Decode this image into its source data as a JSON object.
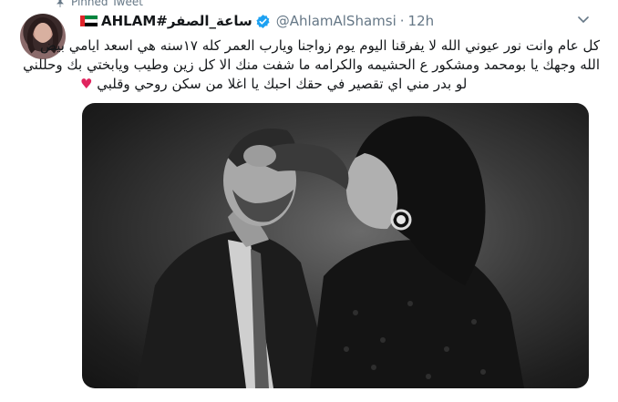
{
  "pinned": {
    "label": "Pinned Tweet"
  },
  "tweet": {
    "display_name_prefix": "AHLAM",
    "display_name_hashtag": "#ساعة_الصفر",
    "handle": "@AhlamAlShamsi",
    "separator": "·",
    "time": "12h",
    "lines": [
      "كل عام وانت نور عيوني الله لا يفرقنا اليوم يوم زواجنا ويارب العمر كله ١٧سنه هي اسعد ايامي بيض",
      "الله وجهك يا بومحمد ومشكور ع الحشيمه والكرامه ما شفت منك الا كل زين وطيب ويابختي بك وحللني",
      "لو بدر مني اي تقصير في حقك احبك يا اغلا من سكن روحي وقلبي"
    ],
    "heart_glyph": "♥"
  },
  "colors": {
    "text": "#14171a",
    "secondary": "#657786",
    "verified": "#1da1f2",
    "heart": "#e0245e",
    "flag_red": "#e0242a",
    "flag_green": "#00843d",
    "flag_white": "#ffffff",
    "flag_black": "#000000"
  },
  "icons": {
    "pin": "pin-icon",
    "verified": "verified-badge-icon",
    "more": "chevron-down-icon",
    "flag": "uae-flag-icon"
  }
}
